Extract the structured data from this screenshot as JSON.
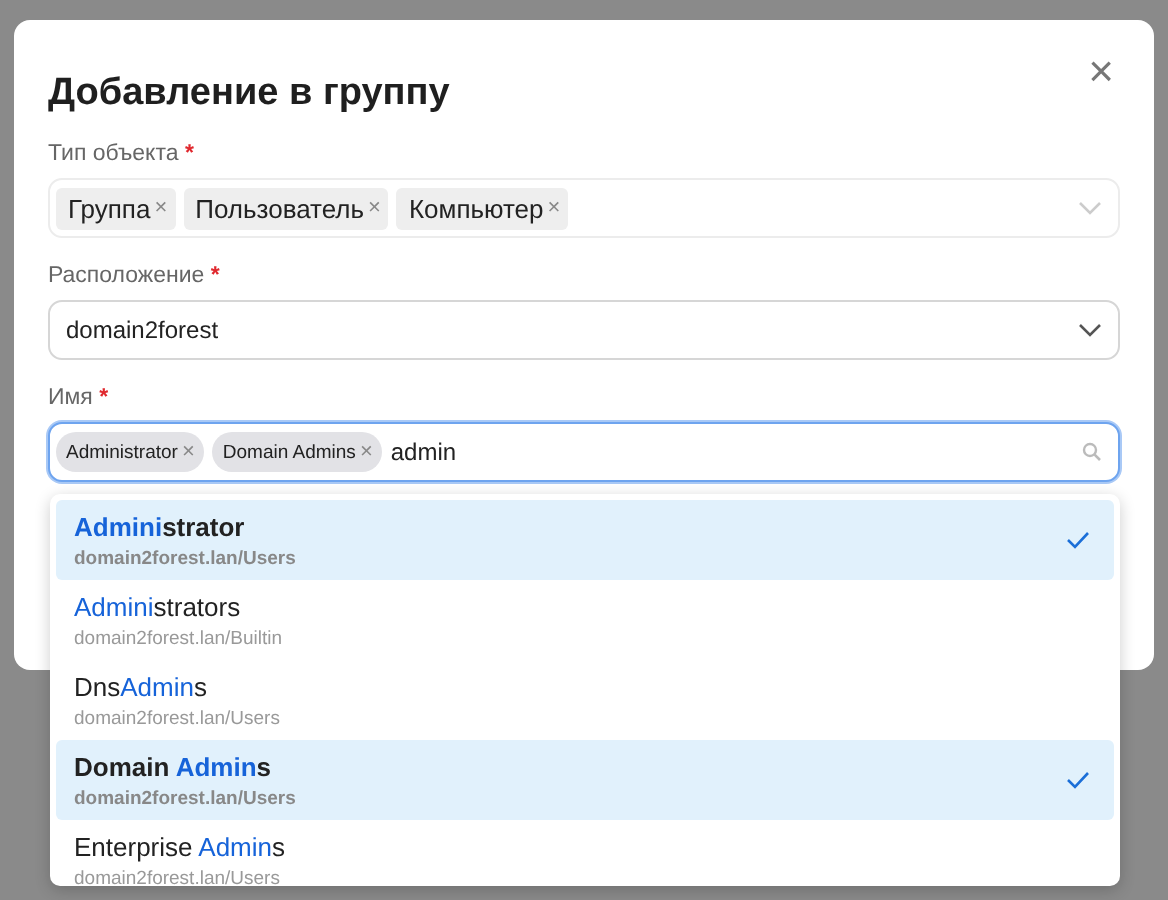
{
  "dialog": {
    "title": "Добавление в группу",
    "close": "×"
  },
  "fields": [
    {
      "kind": "tags",
      "label": "Тип объекта",
      "required_mark": "*",
      "tags": [
        {
          "label": "Группа",
          "remove": "×"
        },
        {
          "label": "Пользователь",
          "remove": "×"
        },
        {
          "label": "Компьютер",
          "remove": "×"
        }
      ],
      "focused": false
    },
    {
      "kind": "select",
      "label": "Расположение",
      "required_mark": "*",
      "value": "domain2forest",
      "focused": false
    },
    {
      "kind": "search",
      "label": "Имя",
      "required_mark": "*",
      "tags": [
        {
          "label": "Administrator",
          "remove": "×"
        },
        {
          "label": "Domain Admins",
          "remove": "×"
        }
      ],
      "value": "admin",
      "focused": true
    }
  ],
  "dropdown": {
    "options": [
      {
        "match": "Admini",
        "after": "strator",
        "path": "domain2forest.lan/Users",
        "selected": true
      },
      {
        "match": "Admini",
        "after": "strators",
        "path": "domain2forest.lan/Builtin",
        "selected": false
      },
      {
        "before": "Dns",
        "match": "Admin",
        "after": "s",
        "path": "domain2forest.lan/Users",
        "selected": false
      },
      {
        "before": "Domain ",
        "match": "Admin",
        "after": "s",
        "path": "domain2forest.lan/Users",
        "selected": true
      },
      {
        "before": "Enterprise ",
        "match": "Admin",
        "after": "s",
        "path": "domain2forest.lan/Users",
        "selected": false
      }
    ]
  }
}
